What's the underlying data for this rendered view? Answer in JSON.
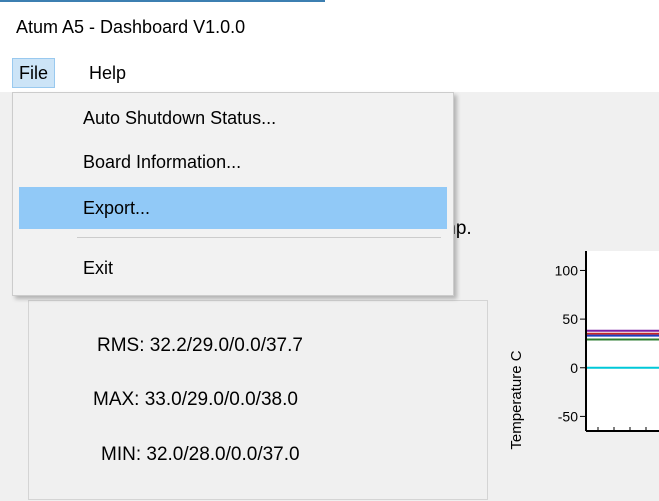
{
  "window": {
    "title": "Atum A5 - Dashboard  V1.0.0"
  },
  "menubar": {
    "file": "File",
    "help": "Help"
  },
  "file_menu": {
    "items": [
      {
        "label": "Auto Shutdown Status...",
        "highlighted": false
      },
      {
        "label": "Board Information...",
        "highlighted": false
      },
      {
        "label": "Export...",
        "highlighted": true
      },
      {
        "label": "Exit",
        "highlighted": false
      }
    ]
  },
  "readings": {
    "partial_label": "mp.",
    "rms": {
      "label": "RMS:",
      "value": "32.2/29.0/0.0/37.7"
    },
    "max": {
      "label": "MAX:",
      "value": "33.0/29.0/0.0/38.0"
    },
    "min": {
      "label": "MIN:",
      "value": "32.0/28.0/0.0/37.0"
    }
  },
  "chart_data": {
    "type": "line",
    "ylabel": "Temperature C",
    "yticks": [
      100,
      50,
      0,
      -50
    ],
    "series_colors": [
      "#7b1fa2",
      "#c62828",
      "#1e3fbf",
      "#2e7d32",
      "#00c8d8"
    ],
    "series_values": [
      38,
      35,
      33,
      29,
      0
    ]
  }
}
